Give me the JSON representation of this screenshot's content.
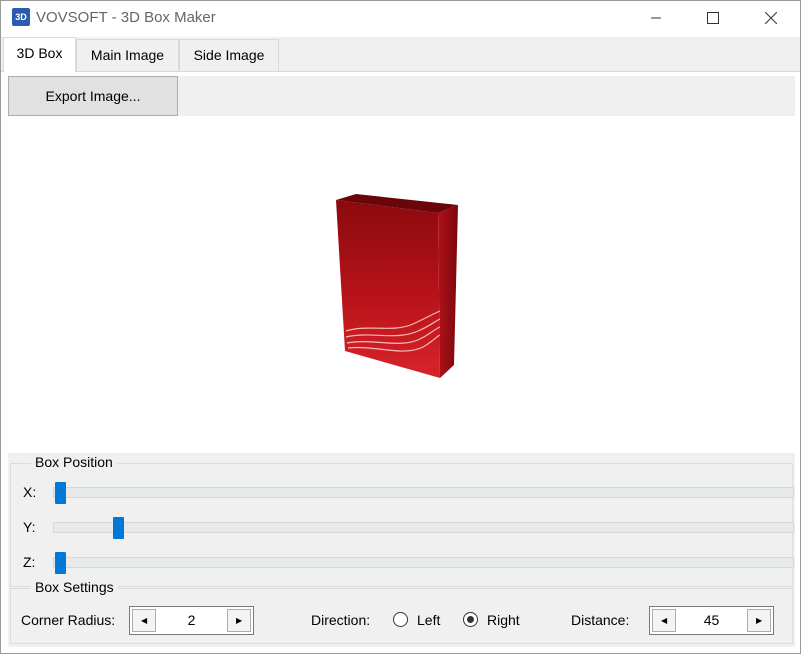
{
  "window": {
    "app_icon_text": "3D",
    "title": "VOVSOFT - 3D Box Maker",
    "controls": [
      "minimize-icon",
      "maximize-icon",
      "close-icon"
    ]
  },
  "tabs": [
    {
      "label": "3D Box",
      "active": true
    },
    {
      "label": "Main Image",
      "active": false
    },
    {
      "label": "Side Image",
      "active": false
    }
  ],
  "toolbar": {
    "export_label": "Export Image..."
  },
  "box_position": {
    "title": "Box Position",
    "x": {
      "label": "X:",
      "level": 0.0
    },
    "y": {
      "label": "Y:",
      "level": 0.08
    },
    "z": {
      "label": "Z:",
      "level": 0.0
    }
  },
  "box_settings": {
    "title": "Box Settings",
    "corner_radius_label": "Corner Radius:",
    "corner_radius_value": "2",
    "direction_label": "Direction:",
    "direction_left": "Left",
    "direction_right": "Right",
    "direction_selected": "Right",
    "distance_label": "Distance:",
    "distance_value": "45"
  },
  "colors": {
    "accent": "#0078d7",
    "box_red": "#b0121a",
    "panel_bg": "#f0f0f0"
  }
}
